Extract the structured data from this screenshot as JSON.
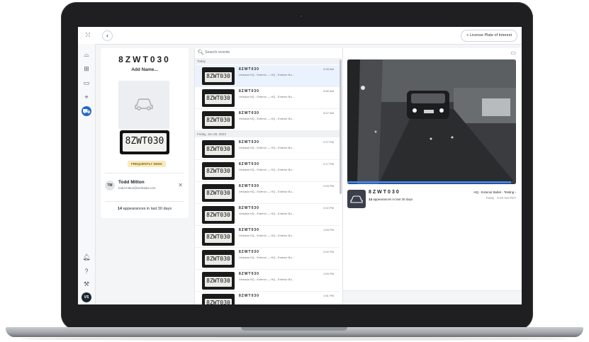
{
  "topbar": {
    "lpi_button_label": "+ License Plate of Interest"
  },
  "rail": {
    "avatar_initials": "VS"
  },
  "profile": {
    "plate_number": "8ZWT030",
    "add_name_label": "Add Name...",
    "plate_image_text": "8ZWT030",
    "badge_label": "FREQUENTLY SEEN",
    "person": {
      "initials": "TM",
      "name": "Todd Mitton",
      "email": "todd.mitton@verkada.com",
      "close_label": "✕"
    },
    "appearances_count": "14",
    "appearances_text": "appearances in last 30 days"
  },
  "events": {
    "search_placeholder": "Search events",
    "groups": [
      {
        "label": "Today"
      },
      {
        "label": "Friday, Jun 30, 2023"
      }
    ],
    "rows": [
      {
        "plate": "8ZWT030",
        "thumb_text": "8ZWT030",
        "desc": "Verkada HQ - Exterior — HQ - Exterior Bu...",
        "time": "8:33 AM"
      },
      {
        "plate": "8ZWT030",
        "thumb_text": "8ZWT030",
        "desc": "Verkada HQ - Exterior — HQ - Exterior Bu...",
        "time": "8:30 AM"
      },
      {
        "plate": "8ZWT030",
        "thumb_text": "8ZWT030",
        "desc": "Verkada HQ - Exterior — HQ - Exterior Bu...",
        "time": "8:27 AM"
      },
      {
        "plate": "8ZWT030",
        "thumb_text": "8ZWT030",
        "desc": "Verkada HQ - Exterior — HQ - Exterior Bu...",
        "time": "2:27 PM"
      },
      {
        "plate": "8ZWT030",
        "thumb_text": "8ZWT030",
        "desc": "Verkada HQ - Exterior — HQ - Exterior Bu...",
        "time": "2:17 PM"
      },
      {
        "plate": "8ZWT030",
        "thumb_text": "8ZWT030",
        "desc": "Verkada HQ - Exterior — HQ - Exterior Bu...",
        "time": "2:03 PM"
      },
      {
        "plate": "8ZWT030",
        "thumb_text": "8ZWT030",
        "desc": "Verkada HQ - Exterior — HQ - Exterior Bu...",
        "time": "2:02 PM"
      },
      {
        "plate": "8ZWT030",
        "thumb_text": "8ZWT030",
        "desc": "Verkada HQ - Exterior — HQ - Exterior Bu...",
        "time": "1:53 PM"
      },
      {
        "plate": "8ZWT030",
        "thumb_text": "8ZWT030",
        "desc": "Verkada HQ - Exterior — HQ - Exterior Bu...",
        "time": "2:02 PM"
      },
      {
        "plate": "8ZWT030",
        "thumb_text": "8ZWT030",
        "desc": "Verkada HQ - Exterior — HQ - Exterior Bu...",
        "time": "1:53 PM"
      },
      {
        "plate": "8ZWT030",
        "thumb_text": "8ZWT030",
        "desc": "",
        "time": "1:51 PM"
      }
    ]
  },
  "viewer": {
    "detail_plate": "8ZWT030",
    "detail_appearances_count": "14",
    "detail_appearances_text": "appearances in last 30 days",
    "camera_label": "HQ - Exterior Bullet - Testing ›",
    "detail_time": "Today · 8:33 AM PDT",
    "timeline_progress": 0.97
  },
  "colors": {
    "accent": "#2767c9",
    "selected_row": "#eaf2fd",
    "badge_bg": "#fbeac0",
    "badge_text": "#8a6410"
  }
}
